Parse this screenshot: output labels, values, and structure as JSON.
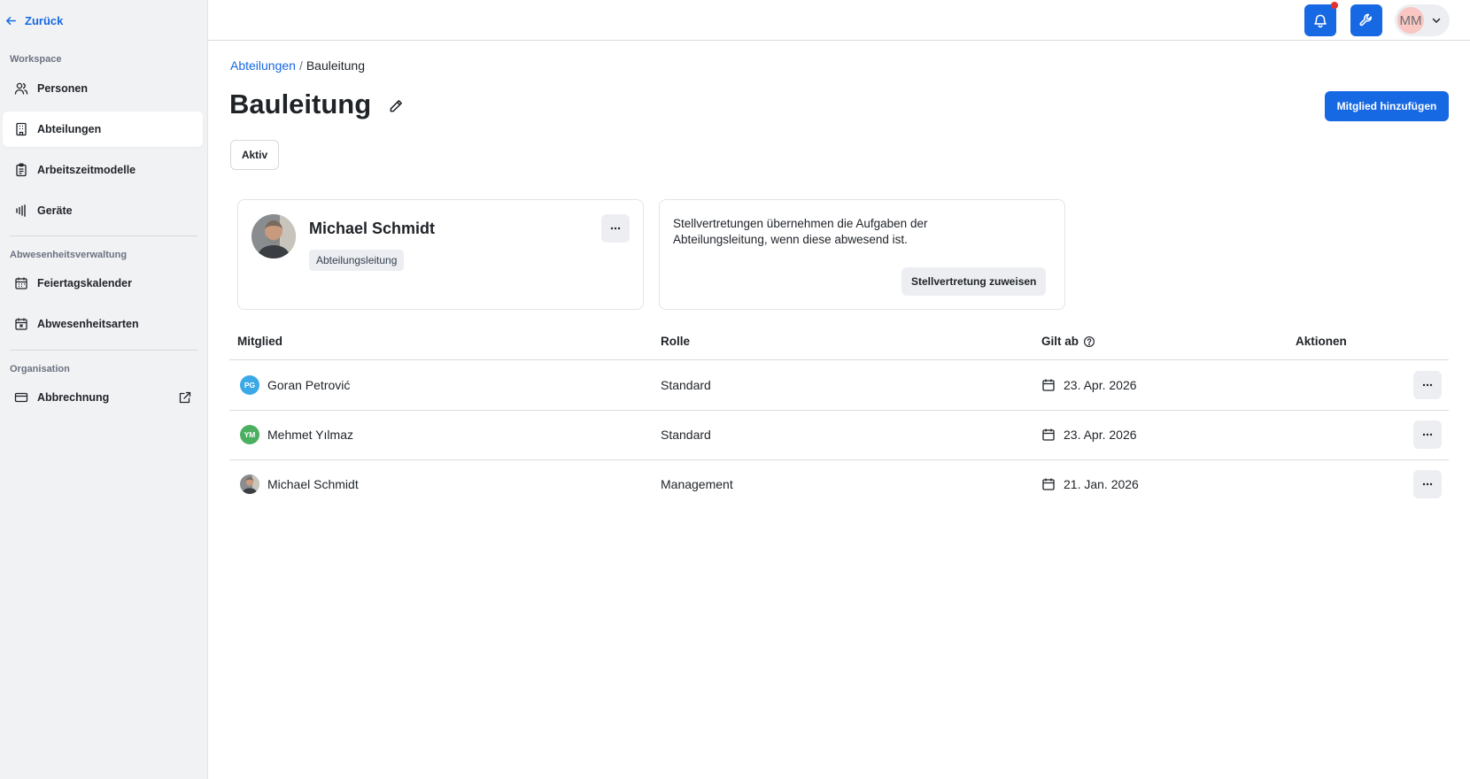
{
  "sidebar": {
    "back_label": "Zurück",
    "sections": {
      "workspace": "Workspace",
      "absence": "Abwesenheitsverwaltung",
      "organisation": "Organisation"
    },
    "items": {
      "personen": "Personen",
      "abteilungen": "Abteilungen",
      "arbeitszeitmodelle": "Arbeitszeitmodelle",
      "geraete": "Geräte",
      "feiertagskalender": "Feiertagskalender",
      "abwesenheitsarten": "Abwesenheitsarten",
      "abbrechnung": "Abbrechnung"
    },
    "active_item": "abteilungen"
  },
  "topbar": {
    "user_initials": "MM",
    "notification_indicator": true,
    "icons": [
      "bell-icon",
      "wrench-icon",
      "chevron-down-icon"
    ]
  },
  "breadcrumb": {
    "parent": "Abteilungen",
    "separator": "/",
    "current": "Bauleitung"
  },
  "page": {
    "title": "Bauleitung",
    "add_member_label": "Mitglied hinzufügen",
    "status": "Aktiv"
  },
  "lead_card": {
    "name": "Michael Schmidt",
    "role": "Abteilungsleitung"
  },
  "substitute_card": {
    "description": "Stellvertretungen übernehmen die Aufgaben der Abteilungsleitung, wenn diese abwesend ist.",
    "button_label": "Stellvertretung zuweisen"
  },
  "table": {
    "headers": {
      "member": "Mitglied",
      "role": "Rolle",
      "valid_from": "Gilt ab",
      "actions": "Aktionen"
    },
    "rows": [
      {
        "initials": "PG",
        "avatar_color": "#3ba9e8",
        "name": "Goran Petrović",
        "role": "Standard",
        "date": "23. Apr. 2026"
      },
      {
        "initials": "YM",
        "avatar_color": "#4caf60",
        "name": "Mehmet Yılmaz",
        "role": "Standard",
        "date": "23. Apr. 2026"
      },
      {
        "initials": "",
        "avatar_color": "",
        "name": "Michael Schmidt",
        "role": "Management",
        "date": "21. Jan. 2026"
      }
    ]
  },
  "colors": {
    "accent": "#1668e3",
    "sidebar_bg": "#f1f2f4",
    "notification_dot": "#e5312c"
  }
}
